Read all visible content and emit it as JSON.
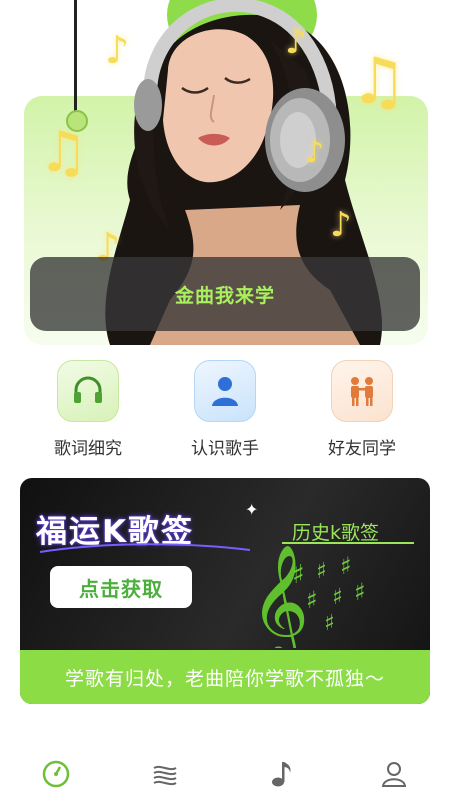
{
  "hero": {
    "banner_title": "金曲我来学"
  },
  "quick_actions": [
    {
      "label": "歌词细究",
      "icon": "headphones-icon"
    },
    {
      "label": "认识歌手",
      "icon": "person-icon"
    },
    {
      "label": "好友同学",
      "icon": "friends-icon"
    }
  ],
  "k_card": {
    "title": "福运K歌签",
    "button": "点击获取",
    "history": "历史k歌签",
    "footer": "学歌有归处，老曲陪你学歌不孤独～"
  },
  "tabbar": {
    "items": [
      {
        "icon": "gauge-icon",
        "active": true
      },
      {
        "icon": "waves-icon",
        "active": false
      },
      {
        "icon": "music-note-icon",
        "active": false
      },
      {
        "icon": "profile-icon",
        "active": false
      }
    ]
  },
  "colors": {
    "accent_green": "#8bdc45",
    "title_green": "#a9f05d",
    "button_text": "#4caf3d"
  }
}
